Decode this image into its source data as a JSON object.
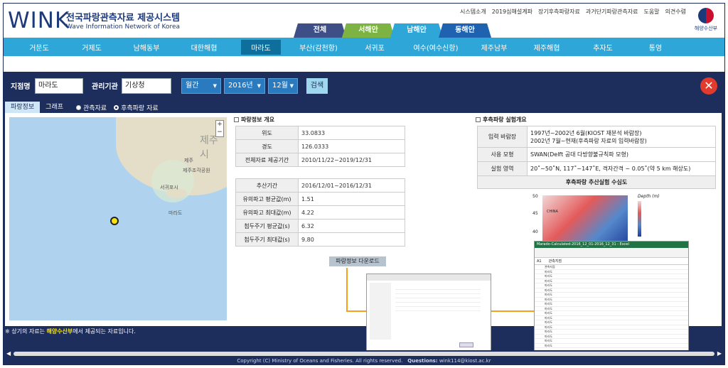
{
  "header": {
    "logo": "WINK",
    "title_kr": "전국파랑관측자료 제공시스템",
    "title_en": "Wave Information Network of Korea",
    "top_links": [
      "시스템소개",
      "2019심해설계파",
      "장기후측파랑자료",
      "과거단기파랑관측자료",
      "도움말",
      "의견수렴"
    ],
    "ministry": "해양수산부",
    "sea_tabs": [
      {
        "label": "전체",
        "color": "#3d4f86"
      },
      {
        "label": "서해안",
        "color": "#7cb342"
      },
      {
        "label": "남해안",
        "color": "#2ea6d8"
      },
      {
        "label": "동해안",
        "color": "#1e62b0"
      }
    ]
  },
  "nav": {
    "items": [
      "거문도",
      "거제도",
      "남해동부",
      "대한해협",
      "마라도",
      "부산(감천항)",
      "서귀포",
      "여수(여수신항)",
      "제주남부",
      "제주해협",
      "추자도",
      "통영"
    ],
    "active": "마라도"
  },
  "search": {
    "station_label": "지점명",
    "station_value": "마라도",
    "agency_label": "관리기관",
    "agency_value": "기상청",
    "period": "월간",
    "year": "2016년",
    "month": "12월",
    "search_button": "검색"
  },
  "tabs": {
    "wave_info": "파랑정보",
    "graph": "그래프",
    "obs_data": "관측자료",
    "hindcast_data": "후측파랑 자료"
  },
  "map": {
    "label_jeju_city": "제주시",
    "label_jeju": "제주",
    "label_seogwipo": "서귀포시",
    "label_marado": "마라도",
    "label_hanla": "제주조각공원"
  },
  "wave_overview": {
    "title": "파랑정보 개요",
    "lat_label": "위도",
    "lat_value": "33.0833",
    "lon_label": "경도",
    "lon_value": "126.0333",
    "period_label": "전체자료 제공기간",
    "period_value": "2010/11/22~2019/12/31",
    "extract_label": "추산기간",
    "extract_value": "2016/12/01~2016/12/31",
    "hs_mean_label": "유의파고 평균값(m)",
    "hs_mean_value": "1.51",
    "hs_max_label": "유의파고 최대값(m)",
    "hs_max_value": "4.22",
    "tp_mean_label": "첨두주기 평균값(s)",
    "tp_mean_value": "6.32",
    "tp_max_label": "첨두주기 최대값(s)",
    "tp_max_value": "9.80",
    "download_button": "파랑정보 다운로드"
  },
  "hindcast": {
    "title": "후측파랑 실험개요",
    "input_label": "입력 바람장",
    "input_value1": "1997년~2002년 6월(KIOST 재분석 바람장)",
    "input_value2": "2002년 7월~현재(후측파랑 자료의 입력바람장)",
    "model_label": "사용 모형",
    "model_value": "SWAN(Delft 공대 다방향불규칙파 모형)",
    "domain_label": "실험 영역",
    "domain_value": "20˚~50˚N, 117˚~147˚E, 격자간격 ~ 0.05˚(약 5 km 해상도)",
    "figure_title": "후측파랑 추산실험 수심도",
    "y_axis": "Latitude",
    "ticks": [
      "50",
      "45",
      "40"
    ],
    "legend": "Depth (m)",
    "china_label": "CHINA"
  },
  "excel": {
    "title": "Marado-Calculated-2016_12_01-2016_12_31 - Excel",
    "cell_ref": "A1",
    "cell_value": "관측지점",
    "rows": [
      "마라도",
      "마라도",
      "마라도",
      "마라도",
      "마라도",
      "마라도",
      "마라도",
      "마라도",
      "마라도",
      "마라도",
      "마라도",
      "마라도",
      "마라도",
      "마라도",
      "마라도",
      "마라도",
      "마라도"
    ],
    "sheet_tab": "Marado-Calculated-2016_12_01-201"
  },
  "footer": {
    "note_pre": "※ 상기의 자료는 ",
    "note_bold": "해양수산부",
    "note_post": "에서 제공되는 자료입니다.",
    "copyright": "Copyright (C) Ministry of Oceans and Fisheries. All rights reserved.",
    "questions_label": "Questions:",
    "email": "wink114@kiost.ac.kr"
  }
}
